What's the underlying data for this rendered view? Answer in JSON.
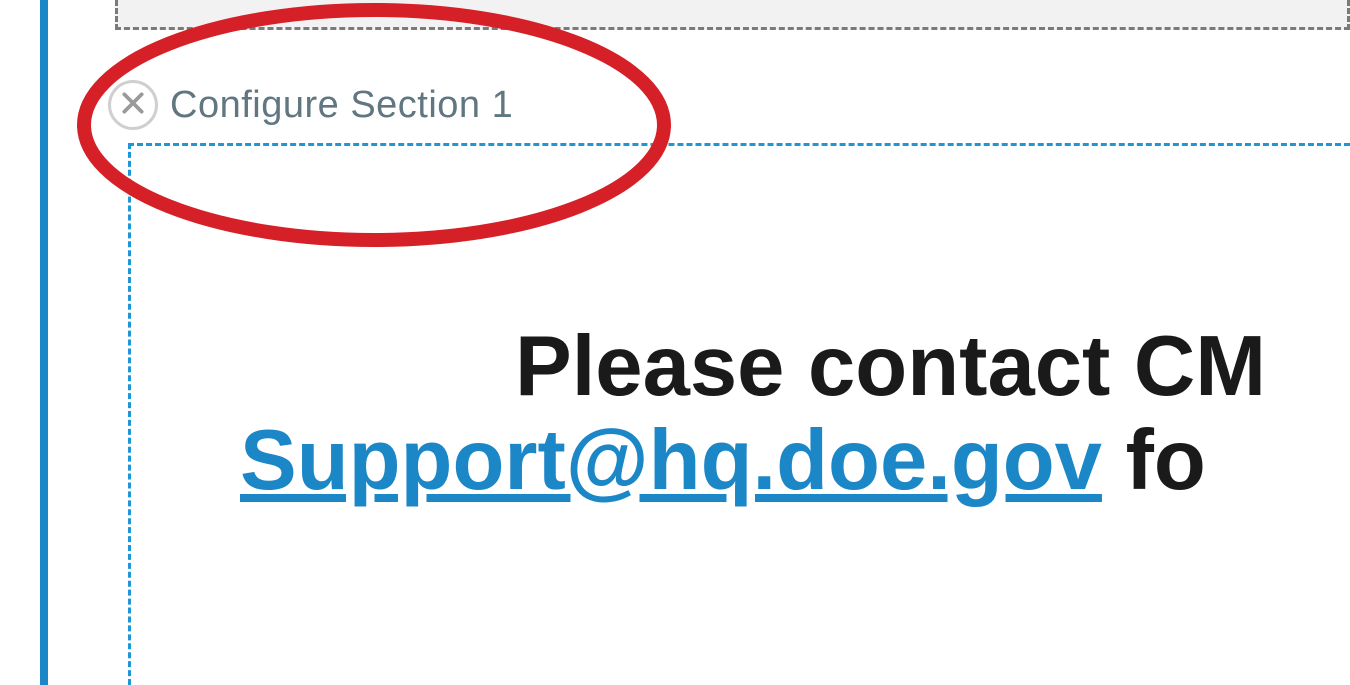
{
  "section": {
    "configure_label": "Configure Section 1"
  },
  "content": {
    "line1_prefix": "Please contact CM",
    "email": "Support@hq.doe.gov",
    "line2_suffix": " fo"
  },
  "colors": {
    "accent": "#1c87c7",
    "annotation": "#d62027"
  }
}
